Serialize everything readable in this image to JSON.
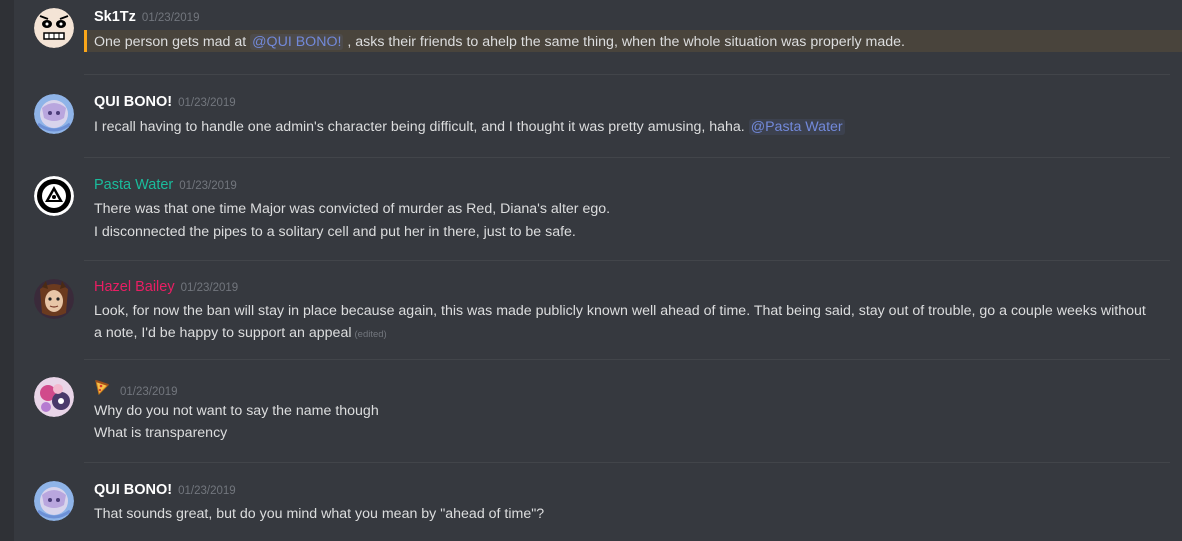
{
  "messages": [
    {
      "username": "Sk1Tz",
      "timestamp": "01/23/2019",
      "highlight": true,
      "line1_pre": "One person gets mad at ",
      "line1_mention": "@QUI BONO!",
      "line1_post": " , asks their friends to ahelp the same thing, when the whole situation was properly made."
    },
    {
      "username": "QUI BONO!",
      "timestamp": "01/23/2019",
      "line1_pre": "I recall having to handle one admin's character being difficult, and I thought it was pretty amusing, haha. ",
      "line1_mention": "@Pasta Water"
    },
    {
      "username": "Pasta Water",
      "timestamp": "01/23/2019",
      "line1": "There was that one time Major was convicted of murder as Red, Diana's alter ego.",
      "line2": "I disconnected the pipes to a solitary cell and put her in there, just to be safe."
    },
    {
      "username": "Hazel Bailey",
      "timestamp": "01/23/2019",
      "line1": "Look, for now the ban will stay in place because again, this was made publicly known well ahead of time.  That being said, stay out of trouble, go a couple weeks without a note, I'd be happy to support an appeal",
      "edited": "(edited)"
    },
    {
      "username": "",
      "username_icon": "pizza-emoji-icon",
      "timestamp": "01/23/2019",
      "line1": "Why do you not want to say the name though",
      "line2": "What is transparency"
    },
    {
      "username": "QUI BONO!",
      "timestamp": "01/23/2019",
      "line1": "That sounds great, but do you mind what you mean by \"ahead of time\"?"
    }
  ],
  "colors": {
    "background": "#36393f",
    "text": "#dcddde",
    "mention": "#7289da",
    "teal_role": "#1abc9c",
    "pink_role": "#e91e63",
    "highlight_bar": "#faa61a"
  }
}
